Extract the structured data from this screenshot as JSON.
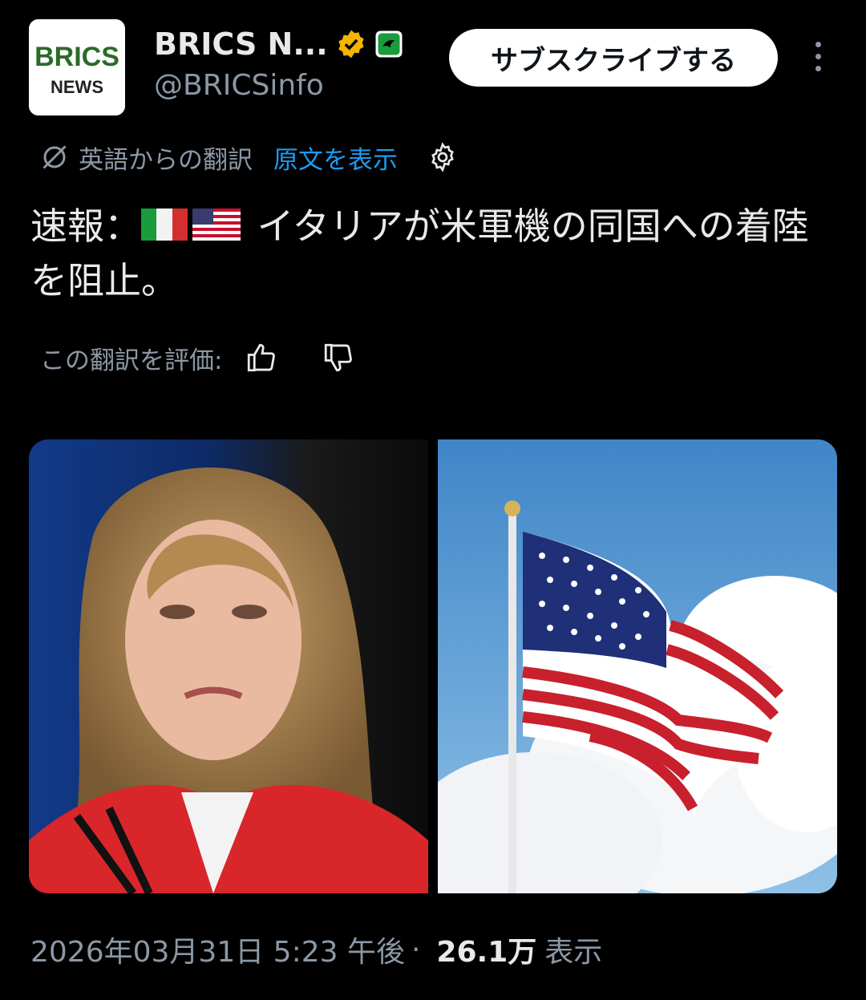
{
  "account": {
    "display_name": "BRICS N...",
    "handle": "@BRICSinfo",
    "avatar_text_top": "BRICS",
    "avatar_text_bottom": "NEWS"
  },
  "subscribe_label": "サブスクライブする",
  "translation": {
    "label": "英語からの翻訳",
    "show_original": "原文を表示"
  },
  "tweet": {
    "text_prefix": "速報：",
    "text_body": " イタリアが米軍機の同国への着陸を阻止。"
  },
  "rating": {
    "label": "この翻訳を評価:"
  },
  "meta": {
    "date": "2026年03月31日 5:23 午後",
    "separator": "·",
    "views": "26.1万",
    "views_label": "表示"
  },
  "colors": {
    "background": "#000000",
    "text": "#e7e9ea",
    "muted": "#8b98a5",
    "link": "#1d9bf0",
    "verified_gold": "#f4b400"
  },
  "icons": {
    "verified": "verified-badge-icon",
    "affiliate": "affiliate-badge-icon",
    "more": "more-icon",
    "translate": "translate-icon",
    "gear": "gear-icon",
    "thumbs_up": "thumbs-up-icon",
    "thumbs_down": "thumbs-down-icon"
  }
}
